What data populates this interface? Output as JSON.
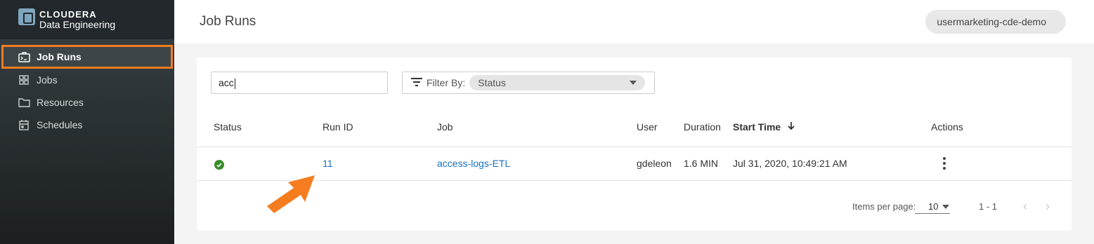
{
  "brand": {
    "name": "CLOUDERA",
    "product": "Data Engineering",
    "icon": "cloudera-logo-icon"
  },
  "sidebar": {
    "items": [
      {
        "label": "Job Runs",
        "icon": "job-runs-icon",
        "active": true
      },
      {
        "label": "Jobs",
        "icon": "grid-icon",
        "active": false
      },
      {
        "label": "Resources",
        "icon": "folder-icon",
        "active": false
      },
      {
        "label": "Schedules",
        "icon": "calendar-icon",
        "active": false
      }
    ]
  },
  "header": {
    "title": "Job Runs",
    "user": "usermarketing-cde-demo"
  },
  "search": {
    "value": "acc"
  },
  "filter": {
    "label": "Filter By:",
    "selected": "Status"
  },
  "table": {
    "columns": [
      "Status",
      "Run ID",
      "Job",
      "User",
      "Duration",
      "Start Time",
      "Actions"
    ],
    "sorted_column": "Start Time",
    "sort_direction": "descending",
    "rows": [
      {
        "status": "success",
        "run_id": "11",
        "job": "access-logs-ETL",
        "user": "gdeleon",
        "duration": "1.6 MIN",
        "start_time": "Jul 31, 2020, 10:49:21 AM"
      }
    ]
  },
  "pagination": {
    "items_per_page_label": "Items per page:",
    "items_per_page": "10",
    "range": "1 - 1"
  },
  "colors": {
    "accent_orange": "#f57c1f",
    "link_blue": "#1672c4",
    "success_green": "#3a8c2a"
  }
}
